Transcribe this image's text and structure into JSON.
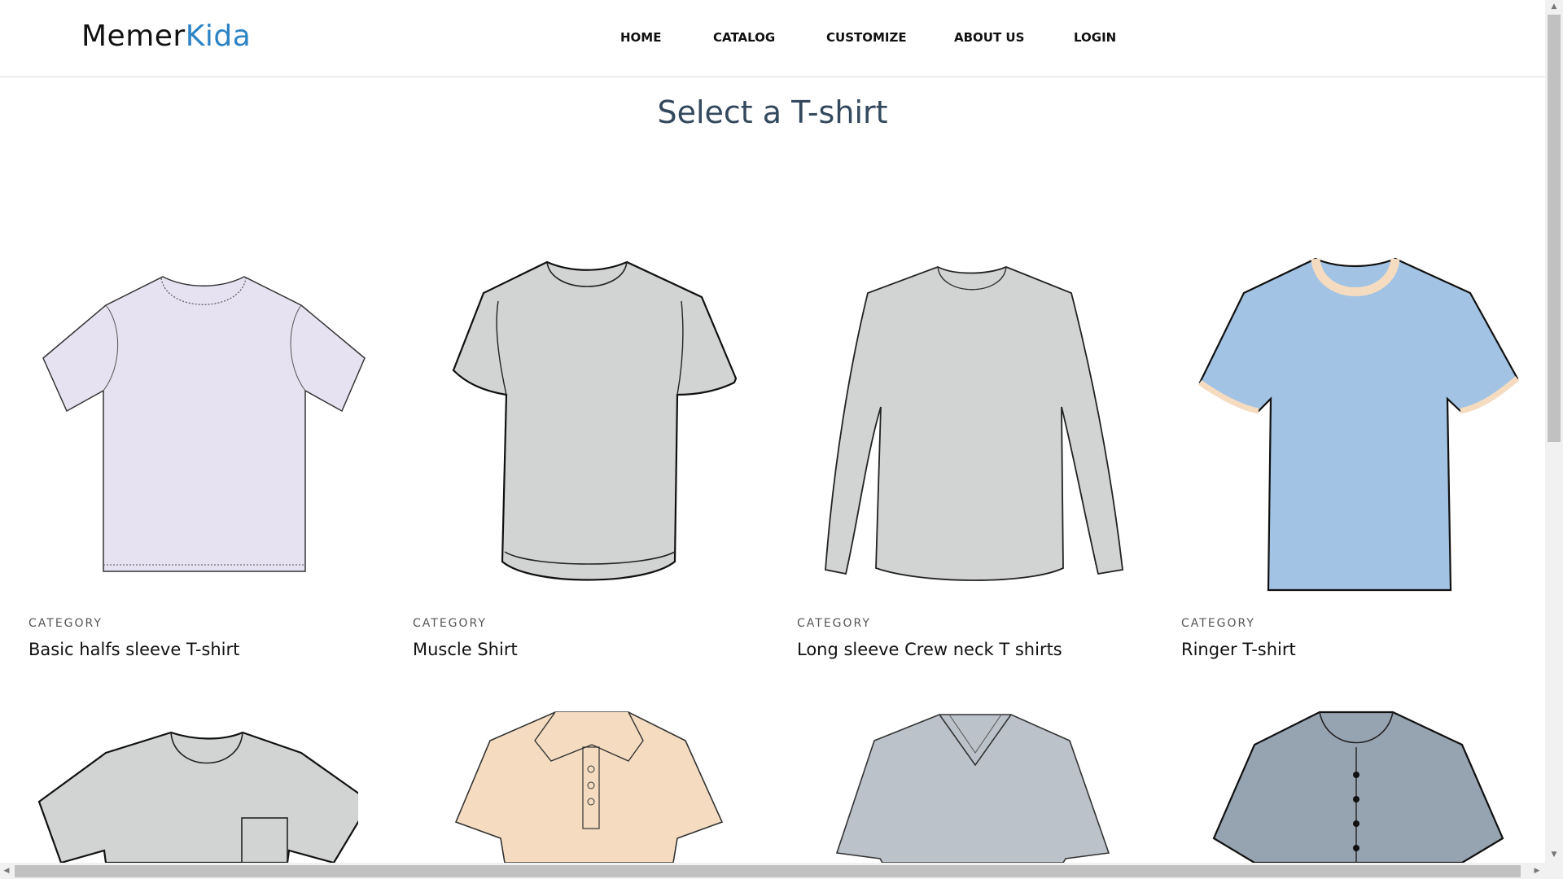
{
  "app": {
    "logo_main": "Memer",
    "logo_accent": "Kida",
    "accent_color": "#2c83c5"
  },
  "nav": {
    "items": [
      {
        "label": "HOME"
      },
      {
        "label": "CATALOG"
      },
      {
        "label": "CUSTOMIZE"
      },
      {
        "label": "ABOUT US"
      },
      {
        "label": "LOGIN"
      }
    ]
  },
  "page": {
    "title": "Select a T-shirt"
  },
  "products": [
    {
      "category": "CATEGORY",
      "name": "Basic halfs sleeve T-shirt",
      "icon": "basic-tshirt-icon",
      "color": "#e6e2f1"
    },
    {
      "category": "CATEGORY",
      "name": "Muscle Shirt",
      "icon": "muscle-shirt-icon",
      "color": "#d2d4d3"
    },
    {
      "category": "CATEGORY",
      "name": "Long sleeve Crew neck T shirts",
      "icon": "long-sleeve-shirt-icon",
      "color": "#d2d4d3"
    },
    {
      "category": "CATEGORY",
      "name": "Ringer T-shirt",
      "icon": "ringer-tshirt-icon",
      "color": "#a2c3e3"
    },
    {
      "category": "",
      "name": "",
      "icon": "pocket-tshirt-icon",
      "color": "#d2d4d3"
    },
    {
      "category": "",
      "name": "",
      "icon": "polo-shirt-icon",
      "color": "#f5dcc1"
    },
    {
      "category": "",
      "name": "",
      "icon": "v-neck-tshirt-icon",
      "color": "#bcc2ca"
    },
    {
      "category": "",
      "name": "",
      "icon": "henley-shirt-icon",
      "color": "#96a3b1"
    }
  ]
}
